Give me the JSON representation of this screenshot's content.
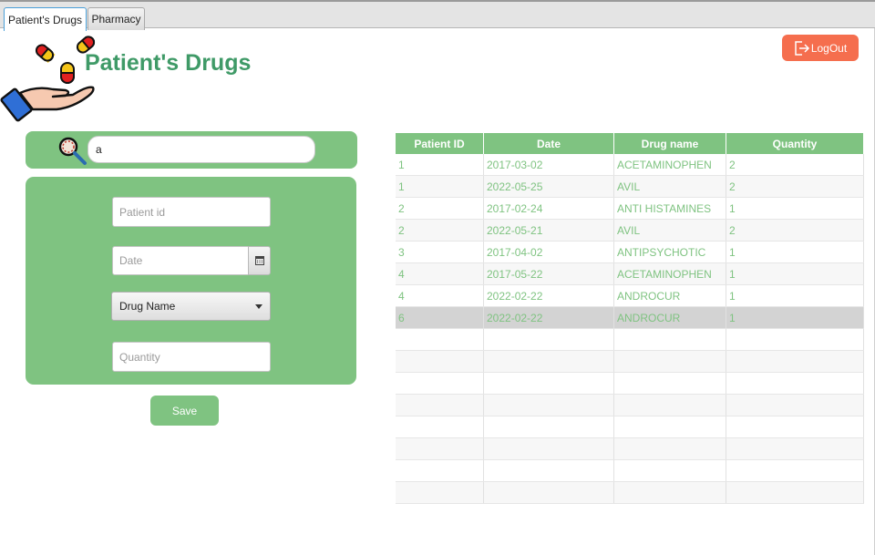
{
  "tabs": [
    {
      "label": "Patient's Drugs",
      "active": true
    },
    {
      "label": "Pharmacy",
      "active": false
    }
  ],
  "header": {
    "title": "Patient's Drugs",
    "logout_label": "LogOut"
  },
  "search": {
    "value": "a"
  },
  "form": {
    "patient_id_placeholder": "Patient id",
    "date_placeholder": "Date",
    "drug_select_value": "Drug Name",
    "quantity_placeholder": "Quantity",
    "save_label": "Save"
  },
  "table": {
    "columns": [
      "Patient ID",
      "Date",
      "Drug name",
      "Quantity"
    ],
    "rows": [
      [
        "1",
        "2017-03-02",
        "ACETAMINOPHEN",
        "2"
      ],
      [
        "1",
        "2022-05-25",
        "AVIL",
        "2"
      ],
      [
        "2",
        "2017-02-24",
        "ANTI HISTAMINES",
        "1"
      ],
      [
        "2",
        "2022-05-21",
        "AVIL",
        "2"
      ],
      [
        "3",
        "2017-04-02",
        "ANTIPSYCHOTIC",
        "1"
      ],
      [
        "4",
        "2017-05-22",
        "ACETAMINOPHEN",
        "1"
      ],
      [
        "4",
        "2022-02-22",
        "ANDROCUR",
        "1"
      ],
      [
        "6",
        "2022-02-22",
        "ANDROCUR",
        "1"
      ]
    ],
    "selected_row": 7,
    "empty_rows": 8
  },
  "colors": {
    "accent_green": "#7fc381",
    "title_green": "#3f9a67",
    "logout_orange": "#f56e4e"
  }
}
